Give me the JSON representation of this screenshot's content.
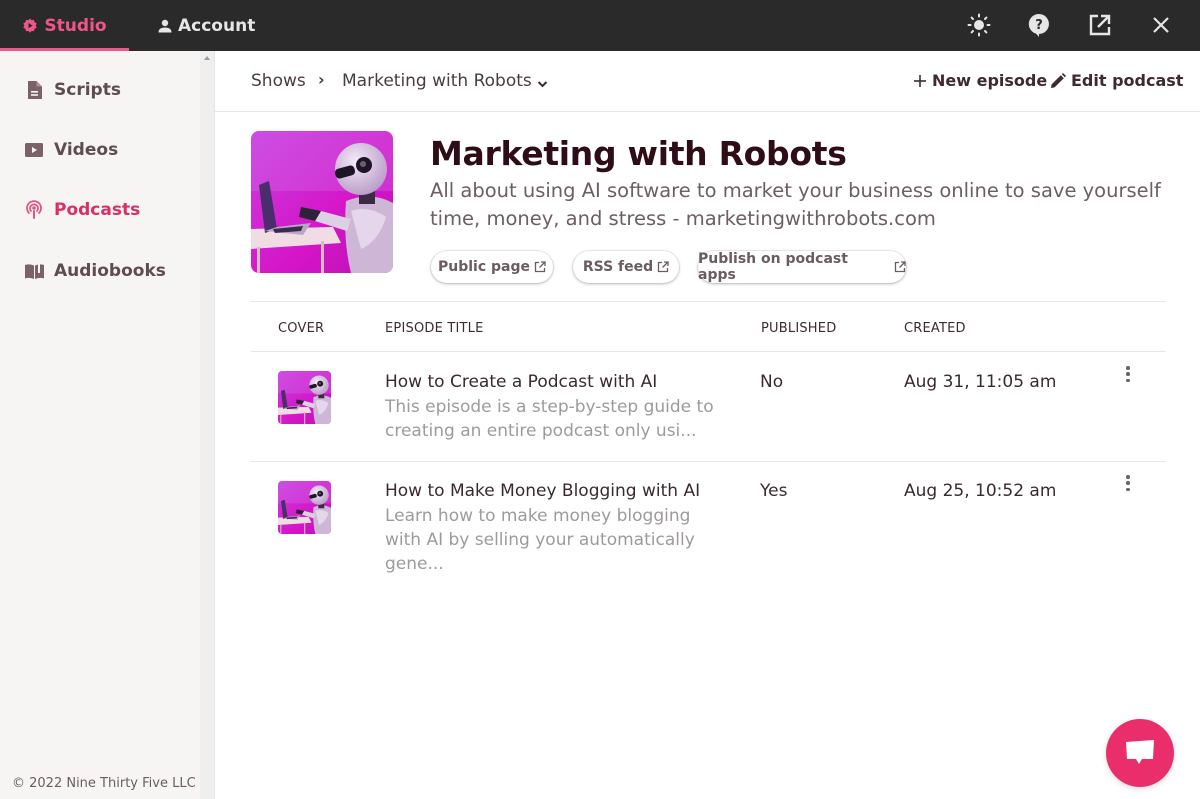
{
  "topbar": {
    "tabs": [
      {
        "label": "Studio",
        "icon": "studio-gear-icon",
        "active": true
      },
      {
        "label": "Account",
        "icon": "user-icon",
        "active": false
      }
    ],
    "icons": [
      "sun-icon",
      "help-icon",
      "open-external-icon",
      "close-icon"
    ]
  },
  "sidebar": {
    "items": [
      {
        "label": "Scripts",
        "icon": "document-icon",
        "active": false
      },
      {
        "label": "Videos",
        "icon": "video-icon",
        "active": false
      },
      {
        "label": "Podcasts",
        "icon": "podcast-icon",
        "active": true
      },
      {
        "label": "Audiobooks",
        "icon": "book-icon",
        "active": false
      }
    ],
    "copyright": "© 2022 Nine Thirty Five LLC"
  },
  "header": {
    "breadcrumb": [
      "Shows",
      "Marketing with Robots"
    ],
    "breadcrumb_separator": "›",
    "new_episode_label": "New episode",
    "edit_podcast_label": "Edit podcast"
  },
  "podcast": {
    "title": "Marketing with Robots",
    "description": "All about using AI software to market your business online to save yourself time, money, and stress - marketingwithrobots.com",
    "links": [
      {
        "label": "Public page"
      },
      {
        "label": "RSS feed"
      },
      {
        "label": "Publish on podcast apps"
      }
    ]
  },
  "table": {
    "columns": [
      "COVER",
      "EPISODE TITLE",
      "PUBLISHED",
      "CREATED"
    ],
    "rows": [
      {
        "title": "How to Create a Podcast with AI",
        "description": "This episode is a step-by-step guide to creating an entire podcast only usi...",
        "published": "No",
        "created": "Aug 31, 11:05 am"
      },
      {
        "title": "How to Make Money Blogging with AI",
        "description": "Learn how to make money blogging with AI by selling your automatically gene...",
        "published": "Yes",
        "created": "Aug 25, 10:52 am"
      }
    ]
  },
  "colors": {
    "accent": "#f0568a",
    "active_nav": "#d92e66",
    "chat_button": "#ea2e6c",
    "topbar": "#2a2a2a",
    "sidebar": "#f7f5f3"
  }
}
